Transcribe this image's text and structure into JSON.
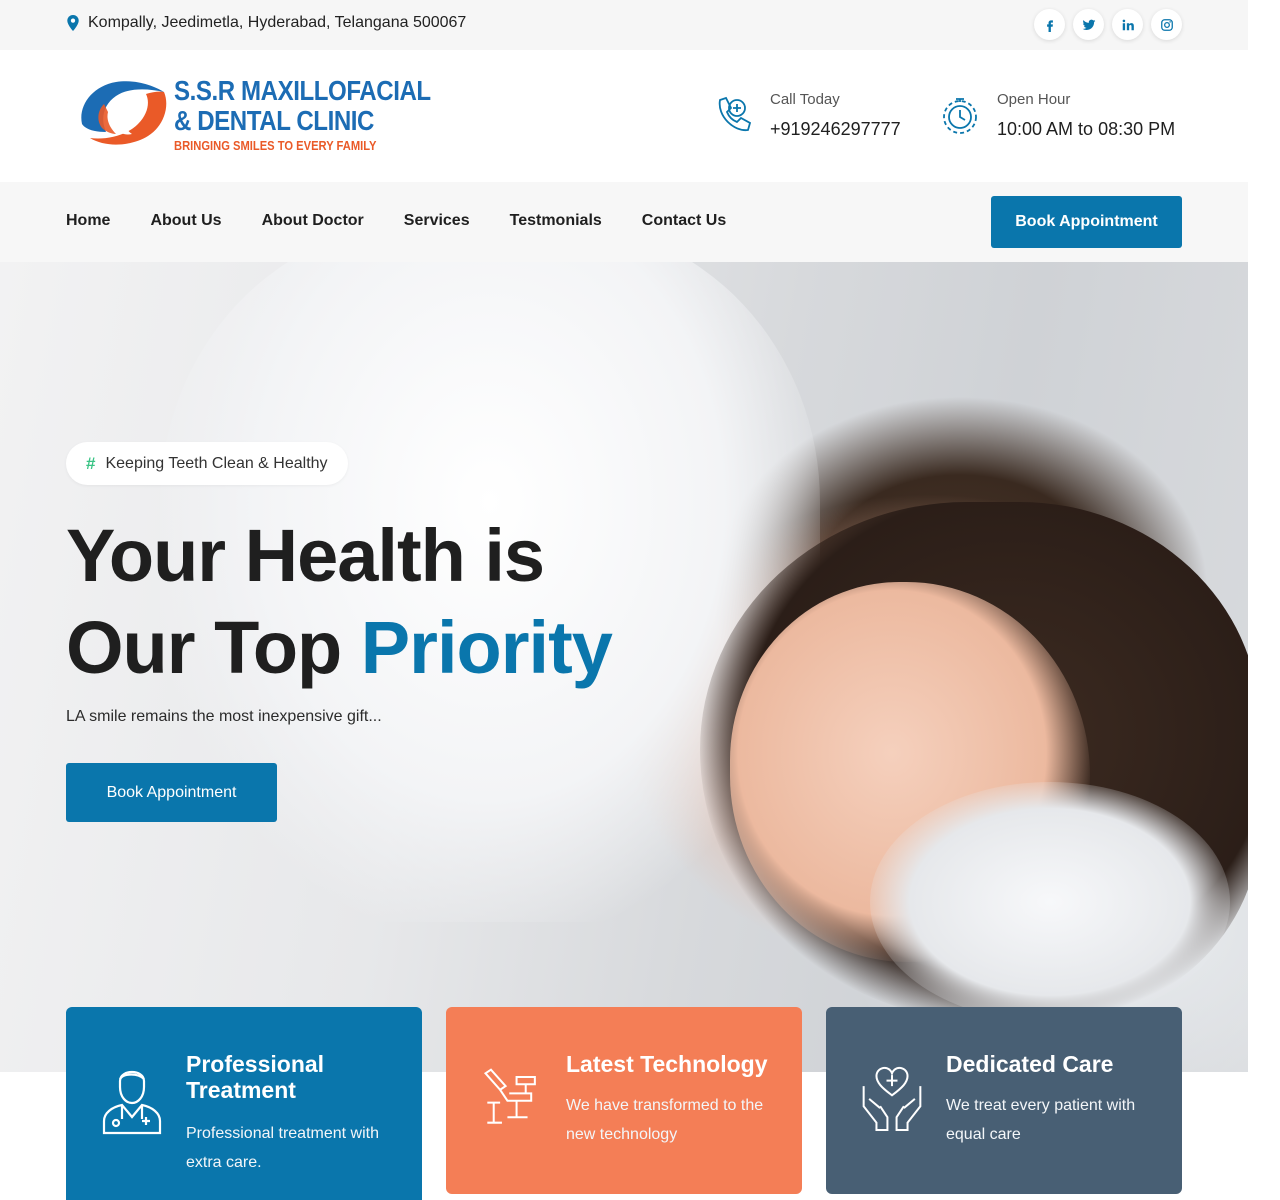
{
  "topbar": {
    "address": "Kompally, Jeedimetla, Hyderabad, Telangana 500067",
    "socials": [
      "facebook-icon",
      "twitter-icon",
      "linkedin-icon",
      "instagram-icon"
    ]
  },
  "header": {
    "logo": {
      "line1": "S.S.R MAXILLOFACIAL",
      "line2": "& DENTAL CLINIC",
      "line3": "BRINGING SMILES TO EVERY FAMILY"
    },
    "call": {
      "label": "Call Today",
      "value": "+919246297777"
    },
    "hours": {
      "label": "Open Hour",
      "value": "10:00 AM to 08:30 PM"
    }
  },
  "nav": {
    "items": [
      "Home",
      "About Us",
      "About Doctor",
      "Services",
      "Testmonials",
      "Contact Us"
    ],
    "cta": "Book Appointment"
  },
  "hero": {
    "badge_icon": "#",
    "badge": "Keeping Teeth Clean & Healthy",
    "title_line1": "Your Health is",
    "title_line2_a": "Our Top ",
    "title_line2_b": "Priority",
    "subtitle": "LA smile remains the most inexpensive gift...",
    "cta": "Book Appointment"
  },
  "features": [
    {
      "title": "Professional Treatment",
      "desc": "Professional treatment with extra care.",
      "icon": "doctor-icon",
      "color": "#0a76ac"
    },
    {
      "title": "Latest Technology",
      "desc": "We have transformed to the new technology",
      "icon": "dental-chair-icon",
      "color": "#f47e56"
    },
    {
      "title": "Dedicated Care",
      "desc": "We treat every patient with equal care",
      "icon": "caring-hands-icon",
      "color": "#485f74"
    }
  ],
  "colors": {
    "primary": "#0a76ac",
    "accent": "#f47e56",
    "slate": "#485f74",
    "badge_hash": "#3bc486"
  }
}
